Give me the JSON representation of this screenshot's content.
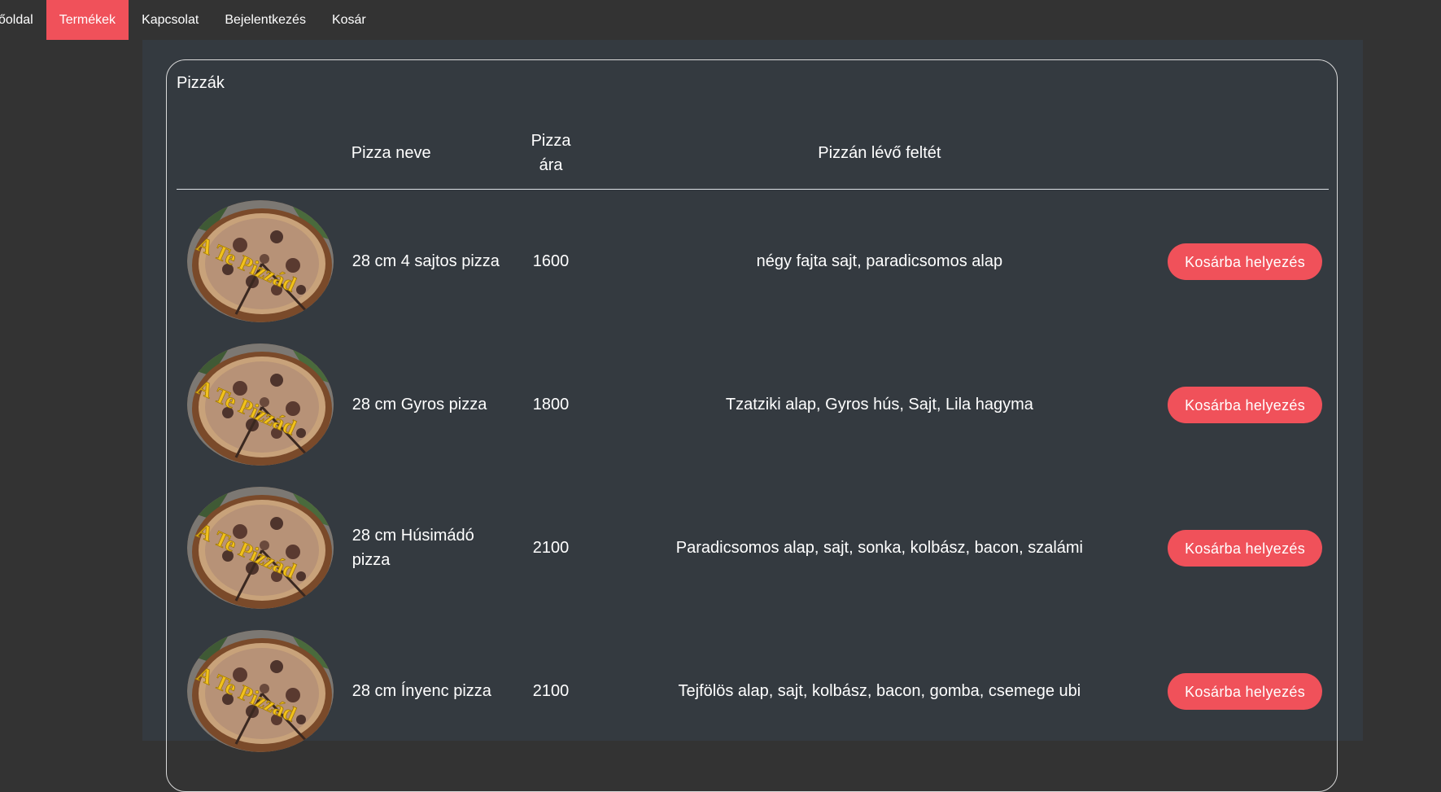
{
  "nav": {
    "items": [
      {
        "label": "őoldal"
      },
      {
        "label": "Termékek"
      },
      {
        "label": "Kapcsolat"
      },
      {
        "label": "Bejelentkezés"
      },
      {
        "label": "Kosár"
      }
    ],
    "active_index": 1
  },
  "card": {
    "title": "Pizzák"
  },
  "table": {
    "headers": {
      "image": "",
      "name": "Pizza neve",
      "price_line1": "Pizza",
      "price_line2": "ára",
      "toppings": "Pizzán lévő feltét",
      "action": ""
    },
    "rows": [
      {
        "name": "28 cm 4 sajtos pizza",
        "price": "1600",
        "toppings": "négy fajta sajt, paradicsomos alap",
        "button": "Kosárba helyezés",
        "image_text": "A Te Pizzád"
      },
      {
        "name": "28 cm Gyros pizza",
        "price": "1800",
        "toppings": "Tzatziki alap, Gyros hús, Sajt, Lila hagyma",
        "button": "Kosárba helyezés",
        "image_text": "A Te Pizzád"
      },
      {
        "name": "28 cm Húsimádó pizza",
        "price": "2100",
        "toppings": "Paradicsomos alap, sajt, sonka, kolbász, bacon, szalámi",
        "button": "Kosárba helyezés",
        "image_text": "A Te Pizzád"
      },
      {
        "name": "28 cm Ínyenc pizza",
        "price": "2100",
        "toppings": "Tejfölös alap, sajt, kolbász, bacon, gomba, csemege ubi",
        "button": "Kosárba helyezés",
        "image_text": "A Te Pizzád"
      }
    ]
  },
  "colors": {
    "background": "#333333",
    "panel": "#343a40",
    "accent": "#f0515a",
    "text": "#ffffff"
  }
}
